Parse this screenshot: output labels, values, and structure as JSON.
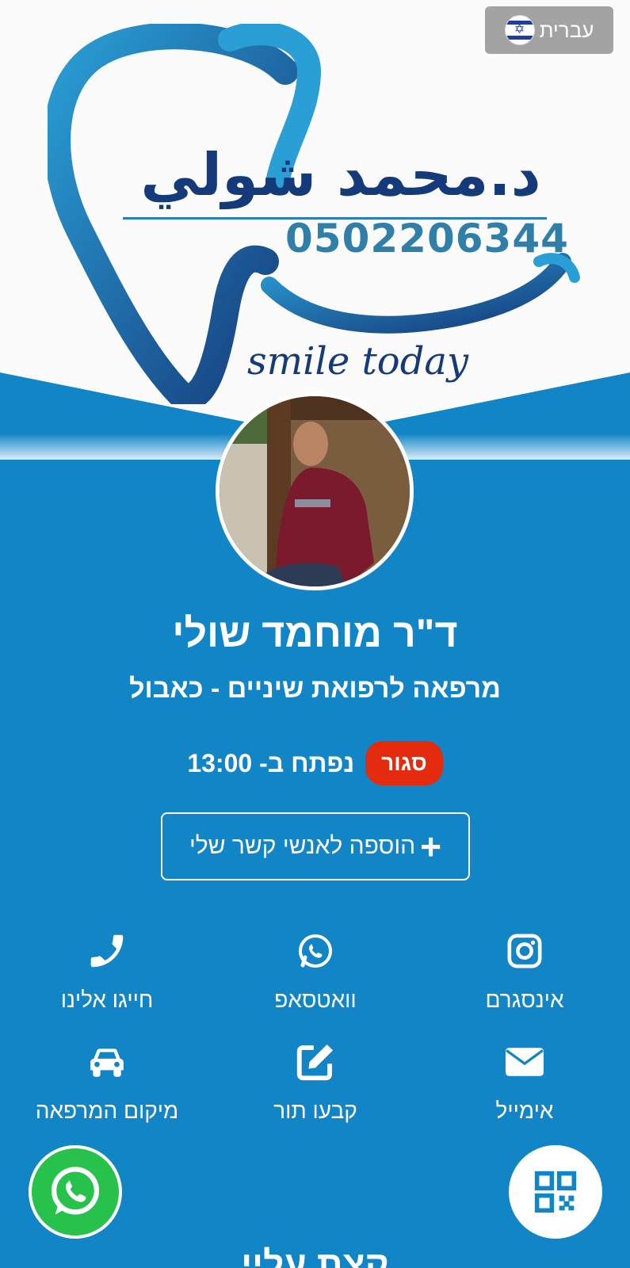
{
  "header": {
    "language_label": "עברית",
    "language_flag_icon": "israel-flag-icon"
  },
  "logo": {
    "name_arabic": "د.محمد شولي",
    "phone": "0502206344",
    "slogan": "smile today",
    "colors": {
      "dark_blue": "#153a7a",
      "light_blue": "#2a9fd6"
    }
  },
  "profile": {
    "name": "ד\"ר מוחמד שולי",
    "subtitle": "מרפאה לרפואת שיניים - כאבול",
    "status_badge": "סגור",
    "status_text": "נפתח ב- 13:00",
    "add_contact_label": "הוספה לאנשי קשר שלי"
  },
  "actions": [
    {
      "label": "חייגו אלינו",
      "icon": "phone-icon"
    },
    {
      "label": "וואטסאפ",
      "icon": "whatsapp-icon"
    },
    {
      "label": "אינסגרם",
      "icon": "instagram-icon"
    },
    {
      "label": "מיקום המרפאה",
      "icon": "car-icon"
    },
    {
      "label": "קבעו תור",
      "icon": "edit-icon"
    },
    {
      "label": "אימייל",
      "icon": "envelope-icon"
    }
  ],
  "floating": {
    "whatsapp_icon": "whatsapp-icon",
    "qr_icon": "qr-code-icon"
  },
  "about": {
    "title": "קצת עליי"
  },
  "colors": {
    "background": "#1285c7",
    "status_closed": "#e42b0e",
    "whatsapp_green": "#27c24b"
  }
}
